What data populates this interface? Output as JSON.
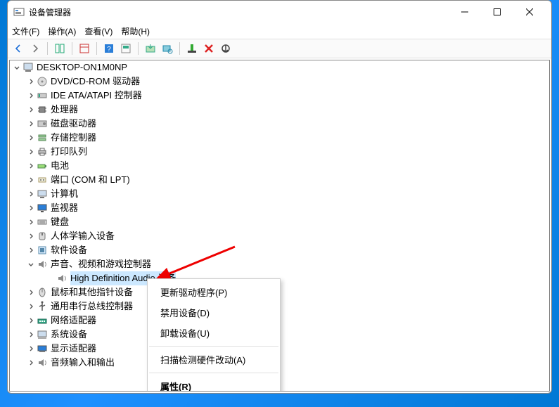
{
  "title": "设备管理器",
  "window_controls": {
    "min": "minimize",
    "max": "maximize",
    "close": "close"
  },
  "menu": {
    "file": "文件(F)",
    "action": "操作(A)",
    "view": "查看(V)",
    "help": "帮助(H)"
  },
  "toolbar_icons": [
    "nav-back",
    "nav-forward",
    "show-hide",
    "properties",
    "help",
    "refresh",
    "update-driver",
    "scan-hardware",
    "add-legacy",
    "uninstall",
    "enable-disable"
  ],
  "root": "DESKTOP-ON1M0NP",
  "nodes": [
    {
      "label": "DVD/CD-ROM 驱动器",
      "icon": "disc"
    },
    {
      "label": "IDE ATA/ATAPI 控制器",
      "icon": "ide"
    },
    {
      "label": "处理器",
      "icon": "cpu"
    },
    {
      "label": "磁盘驱动器",
      "icon": "disk"
    },
    {
      "label": "存储控制器",
      "icon": "storage"
    },
    {
      "label": "打印队列",
      "icon": "printer"
    },
    {
      "label": "电池",
      "icon": "battery"
    },
    {
      "label": "端口 (COM 和 LPT)",
      "icon": "port"
    },
    {
      "label": "计算机",
      "icon": "computer"
    },
    {
      "label": "监视器",
      "icon": "monitor"
    },
    {
      "label": "键盘",
      "icon": "keyboard"
    },
    {
      "label": "人体学输入设备",
      "icon": "hid"
    },
    {
      "label": "软件设备",
      "icon": "software"
    },
    {
      "label": "声音、视频和游戏控制器",
      "icon": "audio",
      "expanded": true,
      "children": [
        {
          "label": "High Definition Audio 设备",
          "icon": "audio",
          "selected": true
        }
      ]
    },
    {
      "label": "鼠标和其他指针设备",
      "icon": "mouse"
    },
    {
      "label": "通用串行总线控制器",
      "icon": "usb"
    },
    {
      "label": "网络适配器",
      "icon": "network"
    },
    {
      "label": "系统设备",
      "icon": "system"
    },
    {
      "label": "显示适配器",
      "icon": "display"
    },
    {
      "label": "音频输入和输出",
      "icon": "audio"
    }
  ],
  "context_menu": {
    "update": "更新驱动程序(P)",
    "disable": "禁用设备(D)",
    "uninstall": "卸载设备(U)",
    "scan": "扫描检测硬件改动(A)",
    "properties": "属性(R)"
  }
}
